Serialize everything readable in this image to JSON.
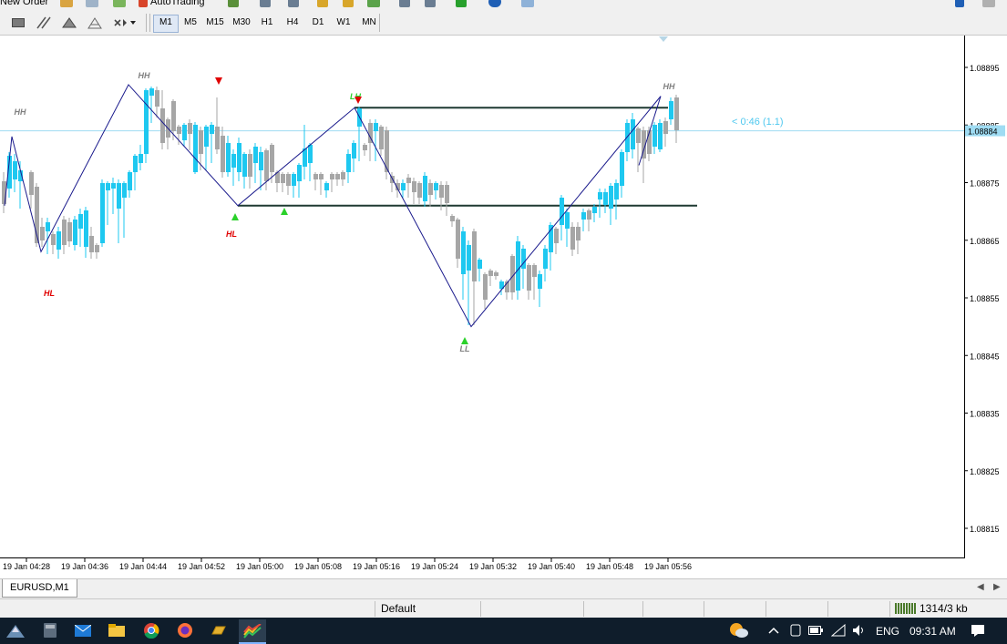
{
  "toolbar": {
    "new_order_label": "New Order",
    "autotrading_label": "AutoTrading",
    "timeframes": [
      "M1",
      "M5",
      "M15",
      "M30",
      "H1",
      "H4",
      "D1",
      "W1",
      "MN"
    ],
    "active_timeframe": "M1"
  },
  "chart": {
    "symbol_tab": "EURUSD,M1",
    "bar_timer": "< 0:46 (1.1)",
    "bid_price": "1.08884",
    "price_ticks": [
      "1.08895",
      "1.08885",
      "1.08875",
      "1.08865",
      "1.08855",
      "1.08845",
      "1.08835",
      "1.08825",
      "1.08815"
    ],
    "time_ticks": [
      "19 Jan 04:28",
      "19 Jan 04:36",
      "19 Jan 04:44",
      "19 Jan 04:52",
      "19 Jan 05:00",
      "19 Jan 05:08",
      "19 Jan 05:16",
      "19 Jan 05:24",
      "19 Jan 05:32",
      "19 Jan 05:40",
      "19 Jan 05:48",
      "19 Jan 05:56"
    ],
    "colors": {
      "bull": "#1ec8f0",
      "bear": "#a6a6a6",
      "zigzag": "#1a1a8c",
      "level": "#1f3a32",
      "bid_line": "#9fdcf3",
      "hl_label": "#e00000",
      "hh_label": "#808080"
    },
    "swing_labels": [
      {
        "text": "HH",
        "color": "hh"
      },
      {
        "text": "HL",
        "color": "hl"
      },
      {
        "text": "HH",
        "color": "hh"
      },
      {
        "text": "HL",
        "color": "hl"
      },
      {
        "text": "LH",
        "color": "lh"
      },
      {
        "text": "LL",
        "color": "hh"
      },
      {
        "text": "HH",
        "color": "hh"
      }
    ]
  },
  "chart_data": {
    "type": "candlestick",
    "symbol": "EURUSD",
    "timeframe": "M1",
    "x_start": "19 Jan 04:28",
    "x_end": "19 Jan 05:56",
    "ylim": [
      1.0881,
      1.08902
    ],
    "grid": false,
    "zigzag": [
      {
        "time": "04:25",
        "price": 1.08871
      },
      {
        "time": "04:26",
        "price": 1.08883
      },
      {
        "time": "04:30",
        "price": 1.08863
      },
      {
        "time": "04:42",
        "price": 1.08892
      },
      {
        "time": "04:57",
        "price": 1.08871
      },
      {
        "time": "05:13",
        "price": 1.08888
      },
      {
        "time": "05:29",
        "price": 1.0885
      },
      {
        "time": "05:55",
        "price": 1.0889
      }
    ],
    "levels": [
      {
        "price": 1.08888,
        "from": "05:13",
        "to": "05:56"
      },
      {
        "price": 1.08871,
        "from": "04:57",
        "to": "06:00"
      }
    ],
    "bid": 1.08884
  },
  "status": {
    "profile": "Default",
    "traffic": "1314/3 kb"
  },
  "taskbar": {
    "language": "ENG",
    "time": "09:31 AM"
  }
}
